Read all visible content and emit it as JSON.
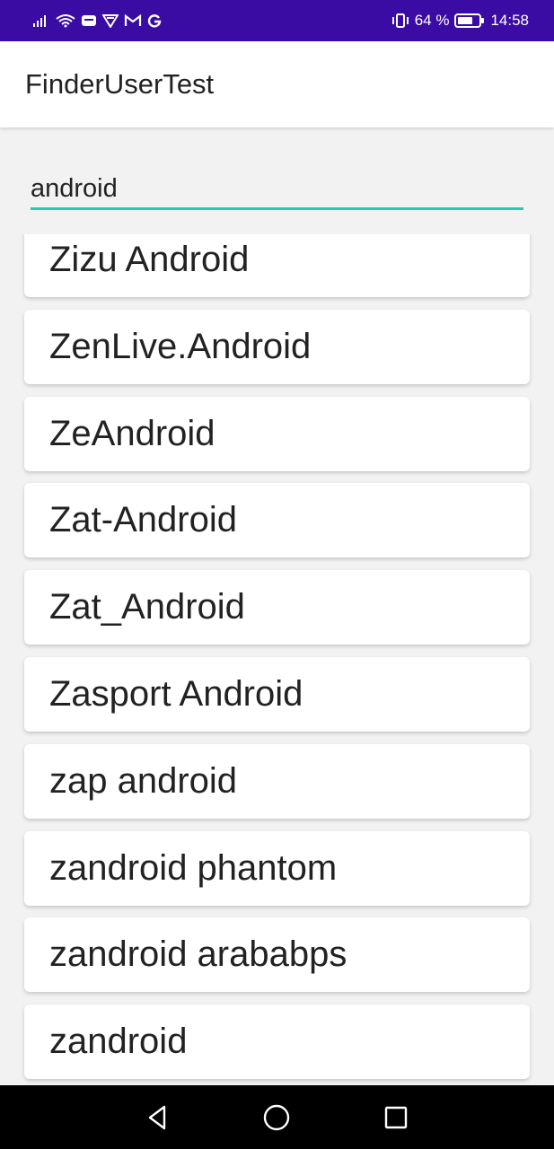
{
  "status_bar": {
    "battery_text": "64 %",
    "time": "14:58",
    "icons": [
      "signal-icon",
      "wifi-icon",
      "notification-icon",
      "vpn-icon",
      "gmail-icon",
      "google-icon",
      "vibrate-icon",
      "battery-icon"
    ]
  },
  "app_bar": {
    "title": "FinderUserTest"
  },
  "search": {
    "value": "android",
    "accent_color": "#2ec7b3"
  },
  "results": [
    "Zizu Android",
    "ZenLive.Android",
    "ZeAndroid",
    "Zat-Android",
    "Zat_Android",
    "Zasport Android",
    "zap android",
    "zandroid phantom",
    "zandroid arababps",
    "zandroid"
  ],
  "nav_bar": {
    "buttons": [
      "back-icon",
      "home-icon",
      "recents-icon"
    ]
  },
  "colors": {
    "status_bar": "#3a0ca3",
    "nav_bar": "#000000",
    "background": "#f2f2f2"
  }
}
